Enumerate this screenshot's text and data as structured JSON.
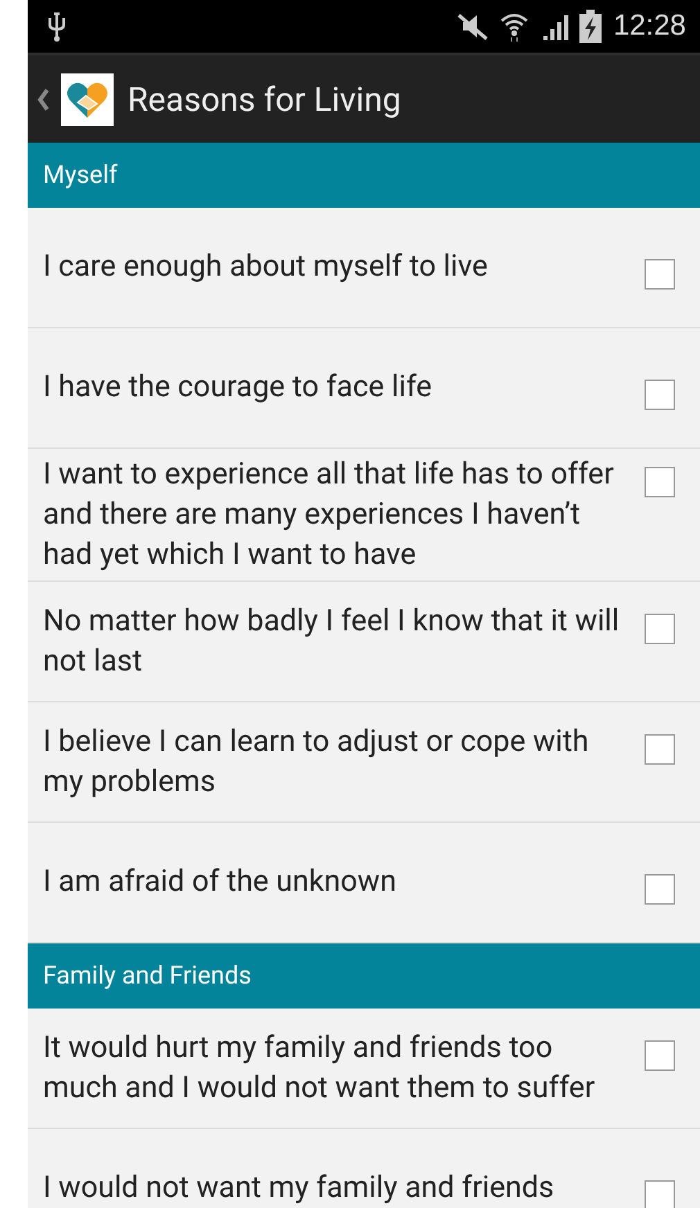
{
  "status_bar": {
    "time": "12:28"
  },
  "app_bar": {
    "title": "Reasons for Living"
  },
  "sections": [
    {
      "title": "Myself",
      "items": [
        {
          "text": "I care enough about myself to live",
          "checked": false
        },
        {
          "text": "I have the courage to face life",
          "checked": false
        },
        {
          "text": "I want to experience all that life has to offer and there are many experiences I haven’t had yet which I want to have",
          "checked": false
        },
        {
          "text": "No matter how badly I feel I know that it will not last",
          "checked": false
        },
        {
          "text": "I believe I can learn to adjust or cope with my problems",
          "checked": false
        },
        {
          "text": "I am afraid of the unknown",
          "checked": false
        }
      ]
    },
    {
      "title": "Family and Friends",
      "items": [
        {
          "text": "It would hurt my family and friends too much and I would not want them to suffer",
          "checked": false
        },
        {
          "text": "I would not want my family and friends",
          "checked": false
        }
      ]
    }
  ]
}
